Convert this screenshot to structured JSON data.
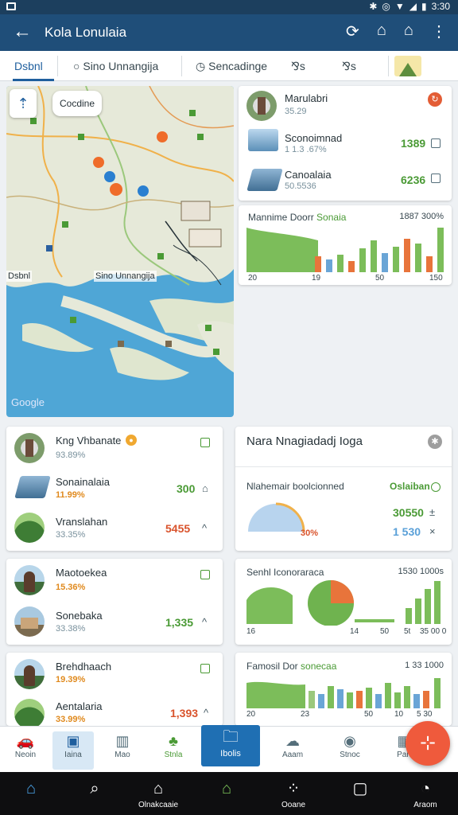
{
  "statusbar": {
    "time": "3:30",
    "icons": [
      "bluetooth-icon",
      "vibrate-icon",
      "wifi-icon",
      "signal-icon",
      "battery-icon"
    ]
  },
  "appbar": {
    "title": "Kola Lonulaia",
    "actions": [
      "share-icon",
      "home-icon",
      "home-alt-icon",
      "more-icon"
    ]
  },
  "tabs": [
    {
      "label": "Dsbnl",
      "active": true
    },
    {
      "label": "Sino Unnangija",
      "icon": "circle-icon"
    },
    {
      "label": "Sencadinge",
      "icon": "clock-icon"
    },
    {
      "label": "⅋s"
    },
    {
      "label": "⅋s"
    }
  ],
  "map": {
    "chip": "Cocdine",
    "labels": [
      "Dsbnl",
      "Sino Unnangija"
    ],
    "credit": "Google"
  },
  "top_card": {
    "title": "Marulabri",
    "sub": "35.29",
    "rows": [
      {
        "name": "Sconoimnad",
        "sub": "1 1.3 .67%",
        "value": "1389"
      },
      {
        "name": "Canoalaia",
        "sub": "50.5536",
        "value": "6236"
      }
    ]
  },
  "top_chart": {
    "title": "Mannime Doorr",
    "title_accent": "Sonaia",
    "value": "1887 300%",
    "ticks": [
      "20",
      "19",
      "50",
      "150"
    ]
  },
  "list_card1": {
    "rows": [
      {
        "name": "Kng Vhbanate",
        "sub": "93.89%"
      },
      {
        "name": "Sonainalaia",
        "sub": "11.99%",
        "value": "300",
        "sym": "⌂"
      },
      {
        "name": "Vranslahan",
        "sub": "33.35%",
        "value": "5455",
        "sym": "^"
      }
    ]
  },
  "list_card2": {
    "rows": [
      {
        "name": "Maotoekea",
        "sub": "15.36%"
      },
      {
        "name": "Sonebaka",
        "sub": "33.38%",
        "value": "1,335",
        "sym": "^"
      }
    ]
  },
  "list_card3": {
    "rows": [
      {
        "name": "Brehdhaach",
        "sub": "19.39%"
      },
      {
        "name": "Aentalaria",
        "sub": "33.99%",
        "value": "1,393",
        "sym": "^"
      }
    ]
  },
  "panel": {
    "title": "Nara Nnagiadadj Ioga",
    "sub_title": "Nlahemair boolcionned",
    "val1": "Oslaiban",
    "val2": "30550",
    "val3": "1 530",
    "gauge_pct": "30%"
  },
  "chart2": {
    "title": "Senhl Iconoraraca",
    "value": "1530 1000s",
    "ticks": [
      "16",
      "14",
      "50",
      "5t",
      "35 00 0"
    ]
  },
  "chart3": {
    "title": "Famosil Dor",
    "title_accent": "sonecaa",
    "value": "1 33 1000",
    "ticks": [
      "20",
      "23",
      "50",
      "10",
      "5 30"
    ]
  },
  "colors": {
    "brand": "#1f4e79",
    "accent": "#1f5f9e",
    "green": "#4a9a35",
    "orange": "#e8743b",
    "red": "#d9532c"
  },
  "bottomnav": [
    {
      "label": "Neoin",
      "icon": "car-icon"
    },
    {
      "label": "Iaina",
      "icon": "book-icon",
      "selected": true
    },
    {
      "label": "Mao",
      "icon": "map-icon"
    },
    {
      "label": "Stnla",
      "icon": "tree-icon"
    },
    {
      "label": "Ibolis",
      "icon": "folder-icon",
      "primary": true
    },
    {
      "label": "Aaam",
      "icon": "cloud-icon"
    },
    {
      "label": "Stnoc",
      "icon": "disc-icon"
    },
    {
      "label": "Pan",
      "icon": "grid-icon"
    }
  ],
  "sysnav": [
    {
      "label": "",
      "icon": "home-icon"
    },
    {
      "label": "",
      "icon": "search-icon"
    },
    {
      "label": "Olnakcaaie",
      "icon": "bank-icon"
    },
    {
      "label": "",
      "icon": "home-outline-icon"
    },
    {
      "label": "Ooane",
      "icon": "apps-icon"
    },
    {
      "label": "",
      "icon": "square-icon"
    },
    {
      "label": "Araom",
      "icon": "bell-icon"
    }
  ]
}
